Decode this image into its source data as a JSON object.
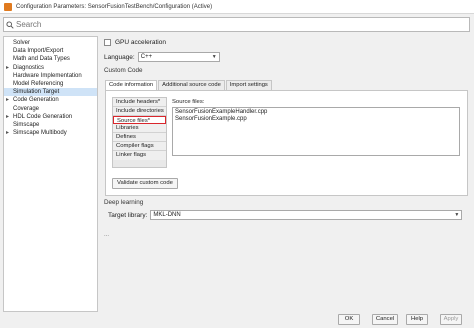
{
  "window": {
    "title": "Configuration Parameters: SensorFusionTestBench/Configuration (Active)"
  },
  "search": {
    "placeholder": "Search"
  },
  "tree": {
    "items": [
      {
        "label": "Solver",
        "expandable": false,
        "selected": false
      },
      {
        "label": "Data Import/Export",
        "expandable": false,
        "selected": false
      },
      {
        "label": "Math and Data Types",
        "expandable": false,
        "selected": false
      },
      {
        "label": "Diagnostics",
        "expandable": true,
        "selected": false
      },
      {
        "label": "Hardware Implementation",
        "expandable": false,
        "selected": false
      },
      {
        "label": "Model Referencing",
        "expandable": false,
        "selected": false
      },
      {
        "label": "Simulation Target",
        "expandable": false,
        "selected": true
      },
      {
        "label": "Code Generation",
        "expandable": true,
        "selected": false
      },
      {
        "label": "Coverage",
        "expandable": false,
        "selected": false
      },
      {
        "label": "HDL Code Generation",
        "expandable": true,
        "selected": false
      },
      {
        "label": "Simscape",
        "expandable": false,
        "selected": false
      },
      {
        "label": "Simscape Multibody",
        "expandable": true,
        "selected": false
      }
    ]
  },
  "main": {
    "gpu_label": "GPU acceleration",
    "language_label": "Language:",
    "language_value": "C++",
    "custom_code_label": "Custom Code",
    "tabs": [
      {
        "label": "Code information",
        "active": true
      },
      {
        "label": "Additional source code",
        "active": false
      },
      {
        "label": "Import settings",
        "active": false
      }
    ],
    "code_items": [
      {
        "label": "Include headers*",
        "selected": false
      },
      {
        "label": "Include directories",
        "selected": false
      },
      {
        "label": "Source files*",
        "selected": true
      },
      {
        "label": "Libraries",
        "selected": false
      },
      {
        "label": "Defines",
        "selected": false
      },
      {
        "label": "Compiler flags",
        "selected": false
      },
      {
        "label": "Linker flags",
        "selected": false
      }
    ],
    "source_files_label": "Source files:",
    "source_files": [
      "SensorFusionExampleHandler.cpp",
      "SensorFusionExample.cpp"
    ],
    "validate_label": "Validate custom code",
    "deep_learning_label": "Deep learning",
    "target_library_label": "Target library:",
    "target_library_value": "MKL-DNN",
    "ellipsis": "..."
  },
  "buttons": {
    "ok": "OK",
    "cancel": "Cancel",
    "help": "Help",
    "apply": "Apply"
  },
  "colors": {
    "selection_bg": "#cfe3f7",
    "highlight_border": "#d9262c",
    "app_icon": "#e07a1f"
  }
}
